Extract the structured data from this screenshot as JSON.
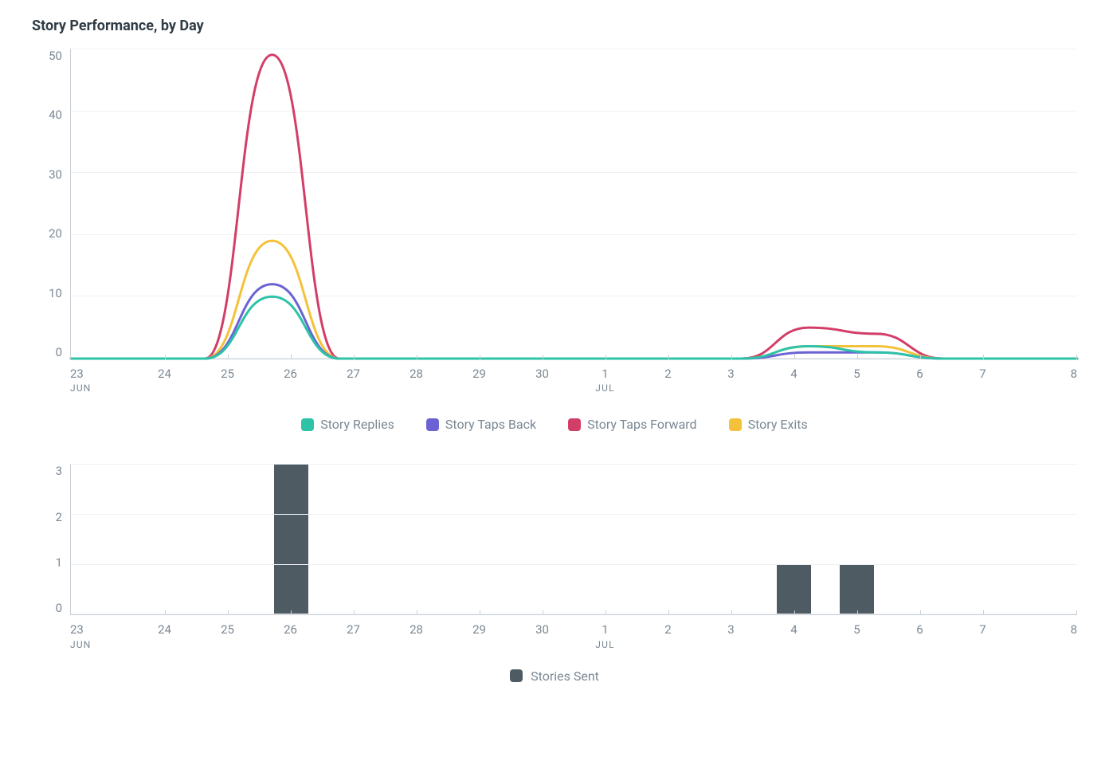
{
  "title": "Story Performance, by Day",
  "chart_data": [
    {
      "type": "line",
      "title": "Story Performance, by Day",
      "xlabel": "",
      "ylabel": "",
      "ylim": [
        0,
        50
      ],
      "yticks": [
        0,
        10,
        20,
        30,
        40,
        50
      ],
      "categories": [
        "23",
        "24",
        "25",
        "26",
        "27",
        "28",
        "29",
        "30",
        "1",
        "2",
        "3",
        "4",
        "5",
        "6",
        "7",
        "8"
      ],
      "month_labels": {
        "23": "JUN",
        "1": "JUL"
      },
      "series": [
        {
          "name": "Story Replies",
          "color": "#2cc3a8",
          "values": [
            0,
            0,
            0,
            10,
            0,
            0,
            0,
            0,
            0,
            0,
            0,
            2,
            1,
            0,
            0,
            0
          ]
        },
        {
          "name": "Story Taps Back",
          "color": "#6b62d3",
          "values": [
            0,
            0,
            0,
            12,
            0,
            0,
            0,
            0,
            0,
            0,
            0,
            1,
            1,
            0,
            0,
            0
          ]
        },
        {
          "name": "Story Taps Forward",
          "color": "#d33e68",
          "values": [
            0,
            0,
            0,
            49,
            0,
            0,
            0,
            0,
            0,
            0,
            0,
            5,
            4,
            0,
            0,
            0
          ]
        },
        {
          "name": "Story Exits",
          "color": "#f3c23a",
          "values": [
            0,
            0,
            0,
            19,
            0,
            0,
            0,
            0,
            0,
            0,
            0,
            2,
            2,
            0,
            0,
            0
          ]
        }
      ]
    },
    {
      "type": "bar",
      "title": "Stories Sent",
      "xlabel": "",
      "ylabel": "",
      "ylim": [
        0,
        3
      ],
      "yticks": [
        0,
        1,
        2,
        3
      ],
      "categories": [
        "23",
        "24",
        "25",
        "26",
        "27",
        "28",
        "29",
        "30",
        "1",
        "2",
        "3",
        "4",
        "5",
        "6",
        "7",
        "8"
      ],
      "month_labels": {
        "23": "JUN",
        "1": "JUL"
      },
      "series": [
        {
          "name": "Stories Sent",
          "color": "#4f5b63",
          "values": [
            0,
            0,
            0,
            3,
            0,
            0,
            0,
            0,
            0,
            0,
            0,
            1,
            1,
            0,
            0,
            0
          ]
        }
      ]
    }
  ]
}
